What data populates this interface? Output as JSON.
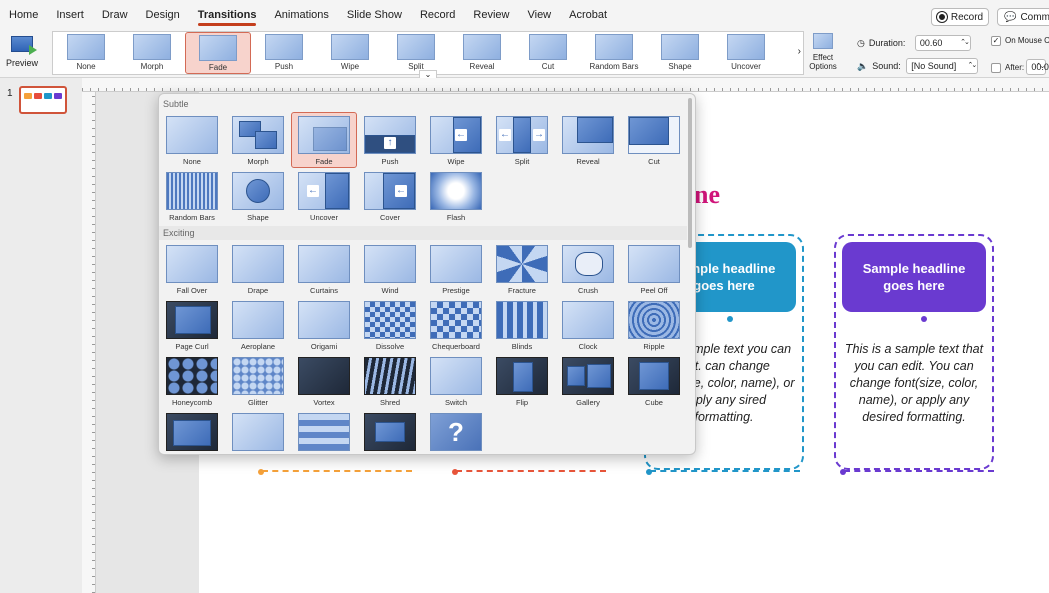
{
  "menu": {
    "tabs": [
      "Home",
      "Insert",
      "Draw",
      "Design",
      "Transitions",
      "Animations",
      "Slide Show",
      "Record",
      "Review",
      "View",
      "Acrobat"
    ],
    "active": "Transitions",
    "record_label": "Record",
    "comments_label": "Comme"
  },
  "ribbon": {
    "preview_label": "Preview",
    "gallery_items": [
      "None",
      "Morph",
      "Fade",
      "Push",
      "Wipe",
      "Split",
      "Reveal",
      "Cut",
      "Random Bars",
      "Shape",
      "Uncover"
    ],
    "selected": "Fade",
    "effect_options_label": "Effect Options",
    "duration_label": "Duration:",
    "duration_value": "00.60",
    "sound_label": "Sound:",
    "sound_value": "[No Sound]",
    "on_mouse_click_label": "On Mouse C",
    "after_label": "After:",
    "after_value": "00.0"
  },
  "thumbs": {
    "slide_number": "1"
  },
  "slide": {
    "title_fragment": "ne",
    "cards": [
      {
        "head": "Sample headline goes here",
        "body": "is a sample text you can edit. can change font(size, color, name), or apply any sired formatting.",
        "color": "#2196c9"
      },
      {
        "head": "Sample headline goes here",
        "body": "This is a sample text that you can edit. You can change font(size, color, name), or apply any desired formatting.",
        "color": "#6a3ad0"
      }
    ]
  },
  "popup": {
    "subtle_label": "Subtle",
    "exciting_label": "Exciting",
    "subtle": [
      "None",
      "Morph",
      "Fade",
      "Push",
      "Wipe",
      "Split",
      "Reveal",
      "Cut",
      "Random Bars",
      "Shape",
      "Uncover",
      "Cover",
      "Flash"
    ],
    "exciting": [
      "Fall Over",
      "Drape",
      "Curtains",
      "Wind",
      "Prestige",
      "Fracture",
      "Crush",
      "Peel Off",
      "Page Curl",
      "Aeroplane",
      "Origami",
      "Dissolve",
      "Chequerboard",
      "Blinds",
      "Clock",
      "Ripple",
      "Honeycomb",
      "Glitter",
      "Vortex",
      "Shred",
      "Switch",
      "Flip",
      "Gallery",
      "Cube"
    ],
    "selected": "Fade"
  }
}
